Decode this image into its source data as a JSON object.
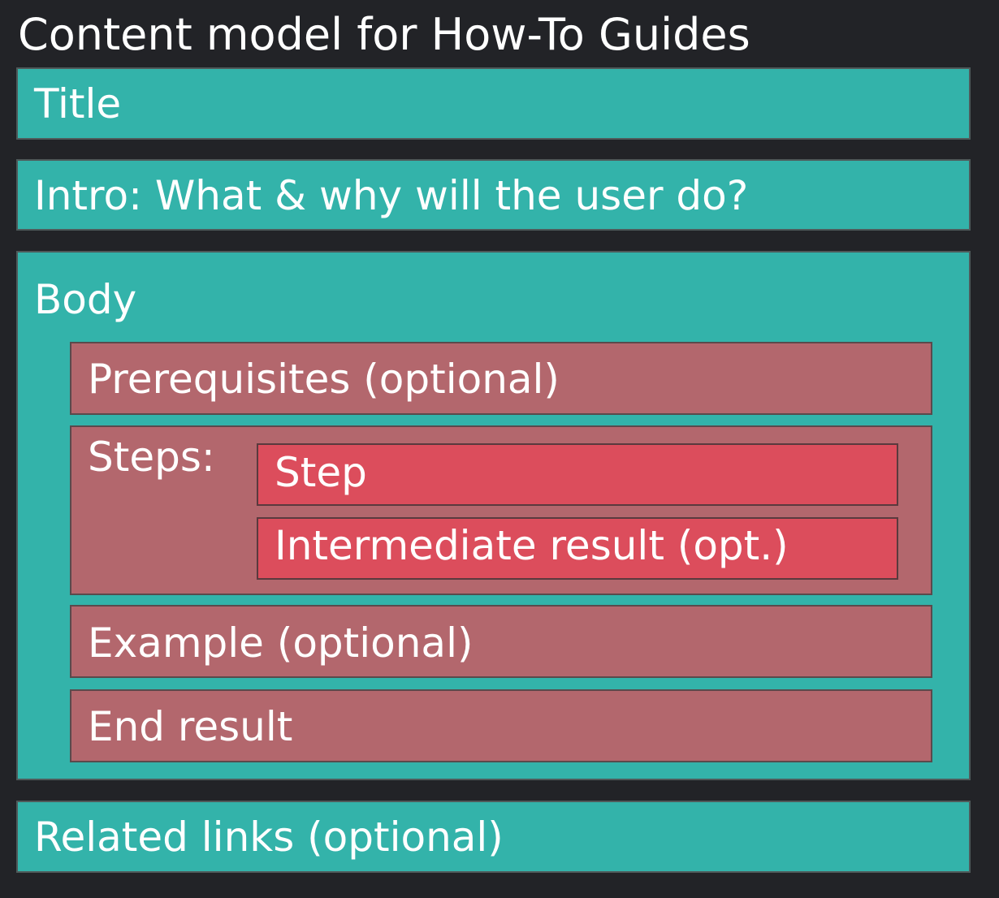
{
  "title": "Content model for How-To Guides",
  "sections": {
    "title": "Title",
    "intro": "Intro: What & why will the user do?",
    "body": "Body",
    "related": "Related links (optional)"
  },
  "body_items": {
    "prerequisites": "Prerequisites (optional)",
    "steps_label": "Steps:",
    "step": "Step",
    "intermediate": "Intermediate result (opt.)",
    "example": "Example (optional)",
    "end_result": "End result"
  },
  "colors": {
    "background": "#222327",
    "section": "#33b3aa",
    "body_item": "#b3676d",
    "step_item": "#dc4d5c"
  }
}
